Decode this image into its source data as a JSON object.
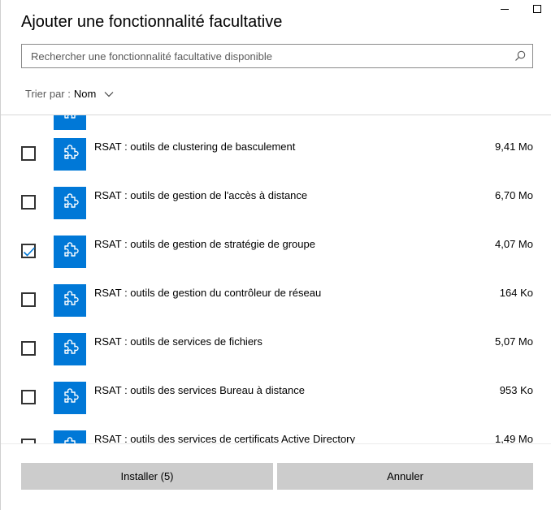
{
  "dialog": {
    "title": "Ajouter une fonctionnalité facultative"
  },
  "search": {
    "placeholder": "Rechercher une fonctionnalité facultative disponible",
    "icon": "search-icon"
  },
  "sort": {
    "label": "Trier par :",
    "value": "Nom"
  },
  "colors": {
    "accent": "#0078d7",
    "button": "#cccccc"
  },
  "features": [
    {
      "name": "",
      "size": "",
      "checked": false
    },
    {
      "name": "RSAT : outils de clustering de basculement",
      "size": "9,41 Mo",
      "checked": false
    },
    {
      "name": "RSAT : outils de gestion de l'accès à distance",
      "size": "6,70 Mo",
      "checked": false
    },
    {
      "name": "RSAT : outils de gestion de stratégie de groupe",
      "size": "4,07 Mo",
      "checked": true
    },
    {
      "name": "RSAT : outils de gestion du contrôleur de réseau",
      "size": "164 Ko",
      "checked": false
    },
    {
      "name": "RSAT : outils de services de fichiers",
      "size": "5,07 Mo",
      "checked": false
    },
    {
      "name": "RSAT : outils des services Bureau à distance",
      "size": "953 Ko",
      "checked": false
    },
    {
      "name": "RSAT : outils des services de certificats Active Directory",
      "size": "1,49 Mo",
      "checked": false
    }
  ],
  "footer": {
    "install_label": "Installer (5)",
    "cancel_label": "Annuler"
  }
}
